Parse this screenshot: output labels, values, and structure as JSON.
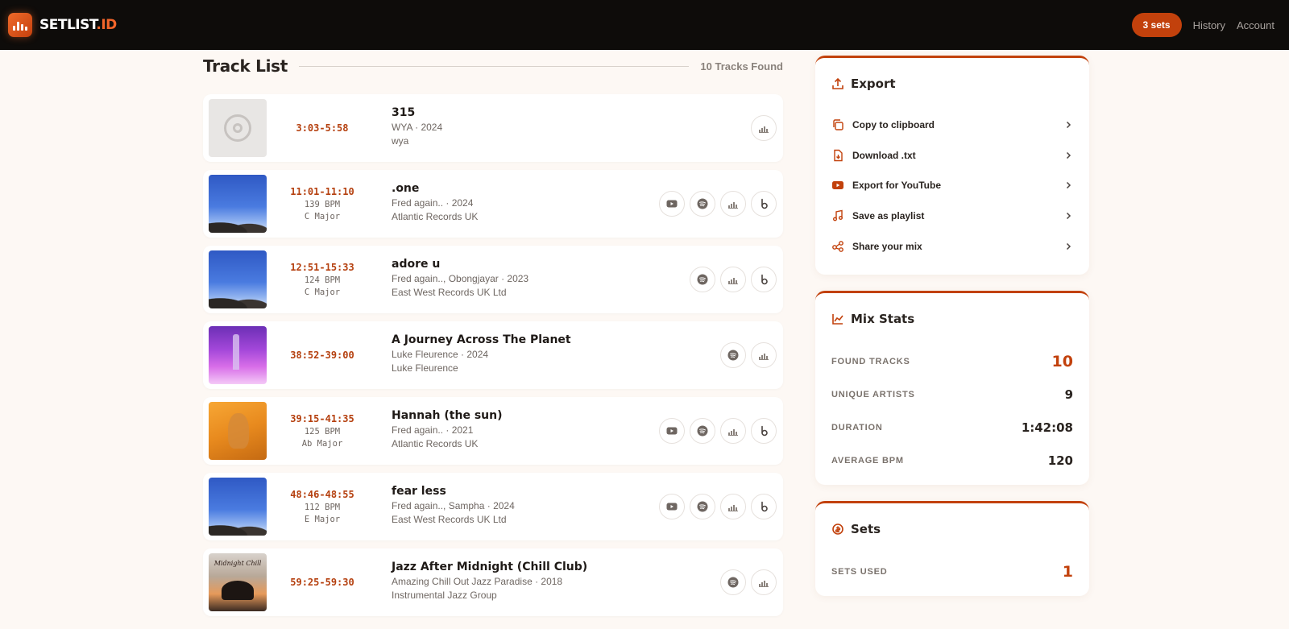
{
  "app": {
    "logo_text": "SETLIST",
    "logo_suffix": ".ID",
    "sets_badge": "3 sets",
    "nav": [
      "History",
      "Account"
    ]
  },
  "track_list": {
    "title": "Track List",
    "count_label": "10 Tracks Found",
    "tracks": [
      {
        "title": "315",
        "time": "3:03-5:58",
        "bpm": "",
        "key": "",
        "sub": "WYA · 2024",
        "label": "wya",
        "cover": "placeholder",
        "actions": [
          "beatport-icon"
        ]
      },
      {
        "title": ".one",
        "time": "11:01-11:10",
        "bpm": "139 BPM",
        "key": "C Major",
        "sub": "Fred again.. · 2024",
        "label": "Atlantic Records UK",
        "cover": "sky",
        "actions": [
          "youtube-icon",
          "spotify-icon",
          "beatport-icon",
          "shazam-icon"
        ]
      },
      {
        "title": "adore u",
        "time": "12:51-15:33",
        "bpm": "124 BPM",
        "key": "C Major",
        "sub": "Fred again.., Obongjayar · 2023",
        "label": "East West Records UK Ltd",
        "cover": "sky",
        "actions": [
          "spotify-icon",
          "beatport-icon",
          "shazam-icon"
        ]
      },
      {
        "title": "A Journey Across The Planet",
        "time": "38:52-39:00",
        "bpm": "",
        "key": "",
        "sub": "Luke Fleurence · 2024",
        "label": "Luke Fleurence",
        "cover": "planet",
        "actions": [
          "spotify-icon",
          "beatport-icon"
        ]
      },
      {
        "title": "Hannah (the sun)",
        "time": "39:15-41:35",
        "bpm": "125 BPM",
        "key": "Ab Major",
        "sub": "Fred again.. · 2021",
        "label": "Atlantic Records UK",
        "cover": "sun",
        "actions": [
          "youtube-icon",
          "spotify-icon",
          "beatport-icon",
          "shazam-icon"
        ]
      },
      {
        "title": "fear less",
        "time": "48:46-48:55",
        "bpm": "112 BPM",
        "key": "E Major",
        "sub": "Fred again.., Sampha · 2024",
        "label": "East West Records UK Ltd",
        "cover": "sky",
        "actions": [
          "youtube-icon",
          "spotify-icon",
          "beatport-icon",
          "shazam-icon"
        ]
      },
      {
        "title": "Jazz After Midnight (Chill Club)",
        "time": "59:25-59:30",
        "bpm": "",
        "key": "",
        "sub": "Amazing Chill Out Jazz Paradise · 2018",
        "label": "Instrumental Jazz Group",
        "cover": "jazz",
        "cover_text": "Midnight Chill",
        "actions": [
          "spotify-icon",
          "beatport-icon"
        ]
      }
    ]
  },
  "export": {
    "title": "Export",
    "items": [
      {
        "label": "Copy to clipboard",
        "icon": "copy-icon"
      },
      {
        "label": "Download .txt",
        "icon": "file-download-icon"
      },
      {
        "label": "Export for YouTube",
        "icon": "youtube-icon"
      },
      {
        "label": "Save as playlist",
        "icon": "music-note-icon"
      },
      {
        "label": "Share your mix",
        "icon": "share-icon"
      }
    ]
  },
  "mix_stats": {
    "title": "Mix Stats",
    "rows": [
      {
        "label": "FOUND TRACKS",
        "value": "10"
      },
      {
        "label": "UNIQUE ARTISTS",
        "value": "9"
      },
      {
        "label": "DURATION",
        "value": "1:42:08"
      },
      {
        "label": "AVERAGE BPM",
        "value": "120"
      }
    ]
  },
  "sets": {
    "title": "Sets",
    "rows": [
      {
        "label": "SETS USED",
        "value": "1"
      }
    ]
  },
  "colors": {
    "accent": "#c2410c",
    "topbar": "#0e0c0a",
    "background": "#fdf8f4"
  }
}
